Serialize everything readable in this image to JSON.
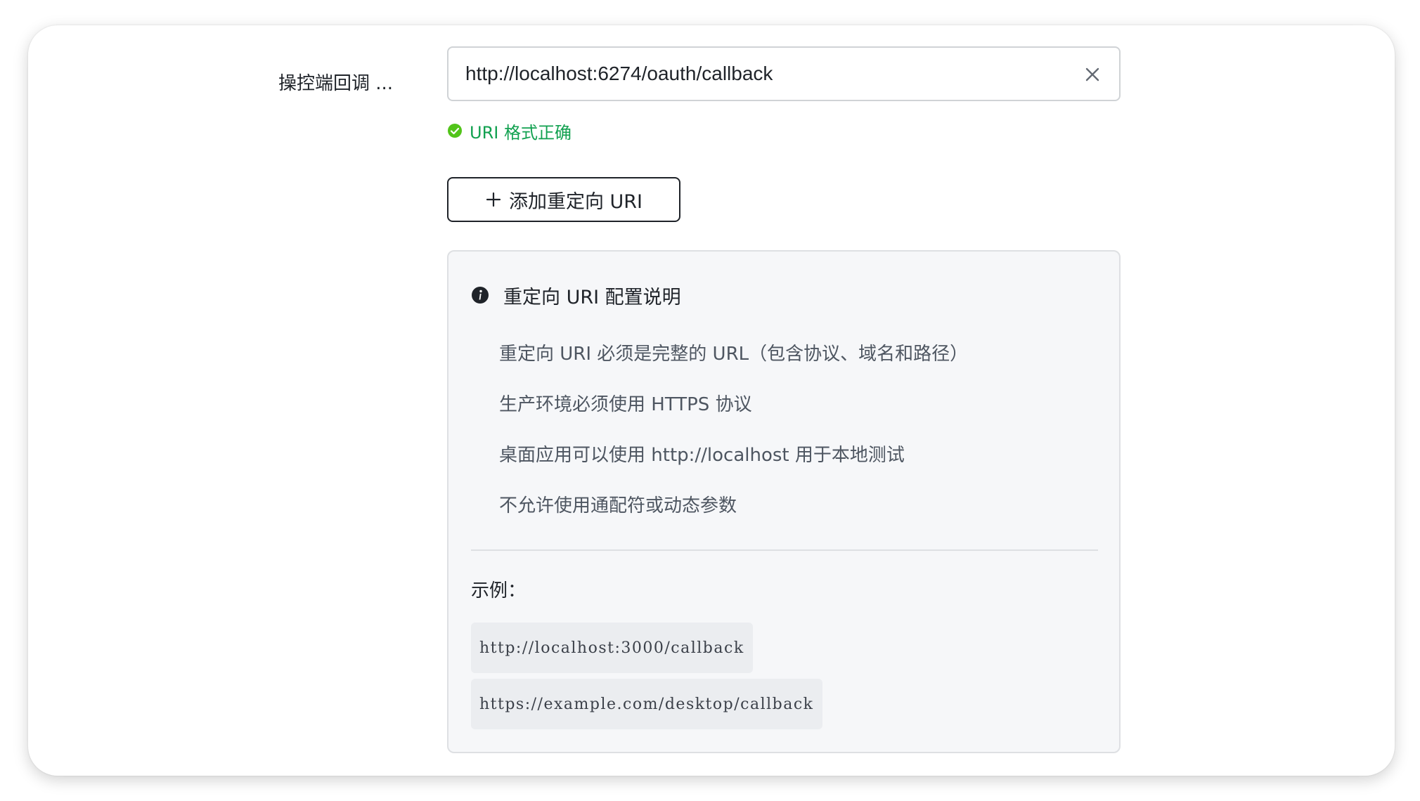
{
  "form": {
    "label": "操控端回调 ...",
    "input_value": "http://localhost:6274/oauth/callback",
    "validation_message": "URI 格式正确",
    "add_button_label": "添加重定向 URI"
  },
  "info": {
    "title": "重定向 URI 配置说明",
    "rules": [
      "重定向 URI 必须是完整的 URL（包含协议、域名和路径）",
      "生产环境必须使用 HTTPS 协议",
      "桌面应用可以使用 http://localhost 用于本地测试",
      "不允许使用通配符或动态参数"
    ],
    "examples_label": "示例：",
    "examples": [
      "http://localhost:3000/callback",
      "https://example.com/desktop/callback"
    ]
  },
  "icons": {
    "clear": "close-icon",
    "valid": "check-circle-icon",
    "add": "plus-icon",
    "info": "info-circle-icon"
  },
  "colors": {
    "success": "#12a150",
    "text_primary": "#1f2329",
    "text_secondary": "#4e5661",
    "panel_bg": "#f6f7f9"
  }
}
